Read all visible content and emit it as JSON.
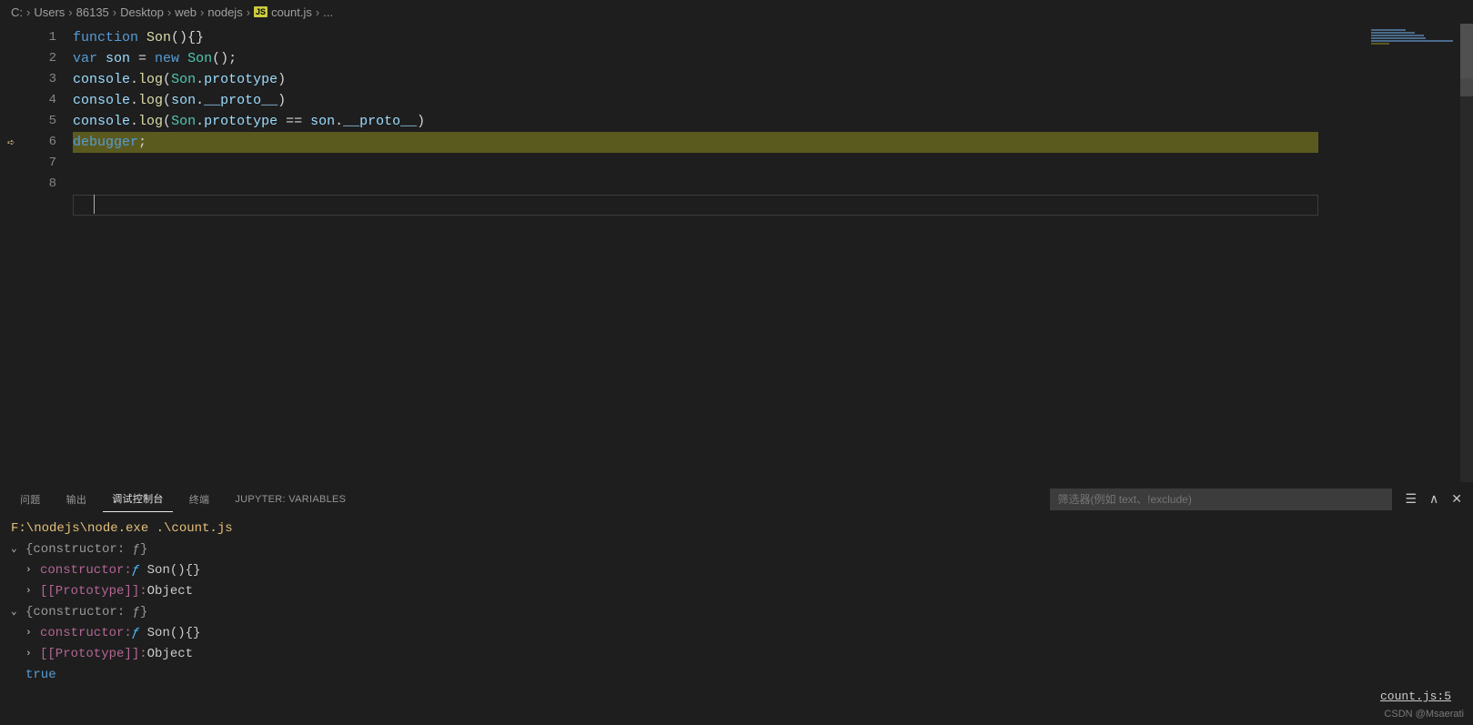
{
  "breadcrumbs": {
    "parts": [
      "C:",
      "Users",
      "86135",
      "Desktop",
      "web",
      "nodejs"
    ],
    "file_badge": "JS",
    "file_name": "count.js",
    "tail": "..."
  },
  "editor": {
    "line_numbers": [
      "1",
      "2",
      "3",
      "4",
      "5",
      "6",
      "7",
      "8"
    ],
    "lines": [
      {
        "tokens": [
          {
            "t": "function ",
            "c": "kw"
          },
          {
            "t": "Son",
            "c": "fn"
          },
          {
            "t": "(){}",
            "c": "pun"
          }
        ]
      },
      {
        "tokens": [
          {
            "t": "var ",
            "c": "kw"
          },
          {
            "t": "son",
            "c": "var"
          },
          {
            "t": " = ",
            "c": "op"
          },
          {
            "t": "new ",
            "c": "new"
          },
          {
            "t": "Son",
            "c": "type"
          },
          {
            "t": "();",
            "c": "pun"
          }
        ]
      },
      {
        "tokens": [
          {
            "t": "console",
            "c": "var"
          },
          {
            "t": ".",
            "c": "pun"
          },
          {
            "t": "log",
            "c": "fn"
          },
          {
            "t": "(",
            "c": "pun"
          },
          {
            "t": "Son",
            "c": "type"
          },
          {
            "t": ".",
            "c": "pun"
          },
          {
            "t": "prototype",
            "c": "var"
          },
          {
            "t": ")",
            "c": "pun"
          }
        ]
      },
      {
        "tokens": [
          {
            "t": "console",
            "c": "var"
          },
          {
            "t": ".",
            "c": "pun"
          },
          {
            "t": "log",
            "c": "fn"
          },
          {
            "t": "(",
            "c": "pun"
          },
          {
            "t": "son",
            "c": "var"
          },
          {
            "t": ".",
            "c": "pun"
          },
          {
            "t": "__proto__",
            "c": "var"
          },
          {
            "t": ")",
            "c": "pun"
          }
        ]
      },
      {
        "tokens": [
          {
            "t": "console",
            "c": "var"
          },
          {
            "t": ".",
            "c": "pun"
          },
          {
            "t": "log",
            "c": "fn"
          },
          {
            "t": "(",
            "c": "pun"
          },
          {
            "t": "Son",
            "c": "type"
          },
          {
            "t": ".",
            "c": "pun"
          },
          {
            "t": "prototype",
            "c": "var"
          },
          {
            "t": " == ",
            "c": "op"
          },
          {
            "t": "son",
            "c": "var"
          },
          {
            "t": ".",
            "c": "pun"
          },
          {
            "t": "__proto__",
            "c": "var"
          },
          {
            "t": ")",
            "c": "pun"
          }
        ]
      },
      {
        "tokens": [
          {
            "t": "debugger",
            "c": "debug"
          },
          {
            "t": ";",
            "c": "pun"
          }
        ]
      },
      {
        "tokens": []
      },
      {
        "tokens": []
      }
    ],
    "highlighted_line_index": 5,
    "cursor_line_index": 7
  },
  "panel": {
    "tabs": [
      {
        "label": "问题",
        "active": false
      },
      {
        "label": "输出",
        "active": false
      },
      {
        "label": "调试控制台",
        "active": true
      },
      {
        "label": "终端",
        "active": false
      },
      {
        "label": "JUPYTER: VARIABLES",
        "active": false
      }
    ],
    "filter_placeholder": "筛选器(例如 text、!exclude)",
    "command": "F:\\nodejs\\node.exe .\\count.js",
    "outputs": [
      {
        "expanded": true,
        "summary": "{constructor: ƒ}",
        "children": [
          {
            "label": "constructor:",
            "value": "ƒ Son(){}"
          },
          {
            "label": "[[Prototype]]:",
            "value": "Object"
          }
        ]
      },
      {
        "expanded": true,
        "summary": "{constructor: ƒ}",
        "children": [
          {
            "label": "constructor:",
            "value": "ƒ Son(){}"
          },
          {
            "label": "[[Prototype]]:",
            "value": "Object"
          }
        ]
      }
    ],
    "final_value": "true",
    "source_link": "count.js:5"
  },
  "watermark": "CSDN @Msaerati"
}
